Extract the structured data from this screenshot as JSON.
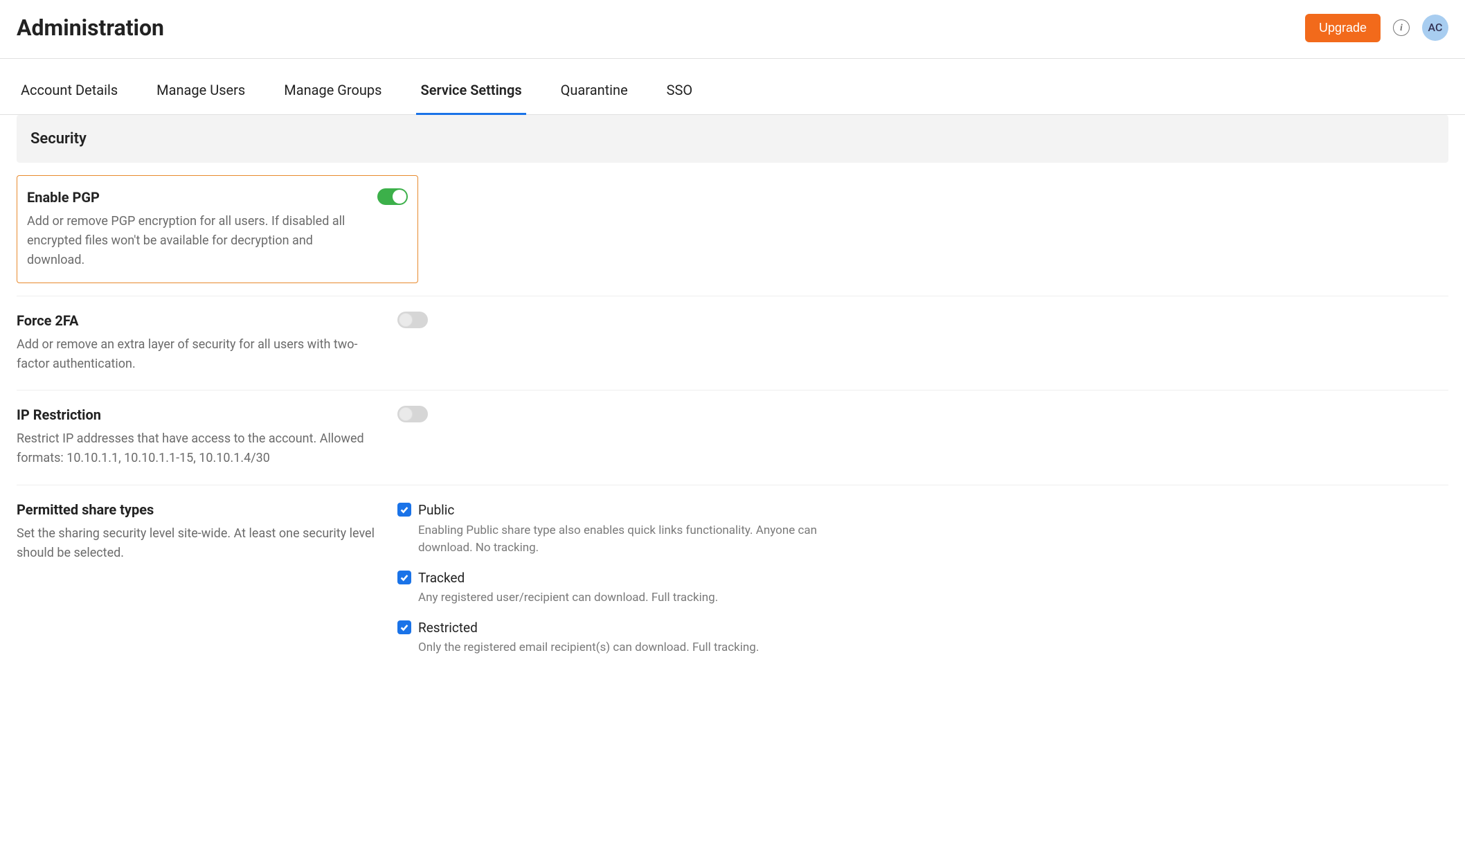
{
  "header": {
    "title": "Administration",
    "upgrade_label": "Upgrade",
    "avatar_initials": "AC"
  },
  "tabs": [
    {
      "label": "Account Details",
      "active": false
    },
    {
      "label": "Manage Users",
      "active": false
    },
    {
      "label": "Manage Groups",
      "active": false
    },
    {
      "label": "Service Settings",
      "active": true
    },
    {
      "label": "Quarantine",
      "active": false
    },
    {
      "label": "SSO",
      "active": false
    }
  ],
  "section": {
    "title": "Security"
  },
  "settings": {
    "enable_pgp": {
      "title": "Enable PGP",
      "desc": "Add or remove PGP encryption for all users. If disabled all encrypted files won't be available for decryption and download.",
      "on": true
    },
    "force_2fa": {
      "title": "Force 2FA",
      "desc": "Add or remove an extra layer of security for all users with two-factor authentication.",
      "on": false
    },
    "ip_restriction": {
      "title": "IP Restriction",
      "desc": "Restrict IP addresses that have access to the account. Allowed formats: 10.10.1.1, 10.10.1.1-15, 10.10.1.4/30",
      "on": false
    },
    "permitted_share_types": {
      "title": "Permitted share types",
      "desc": "Set the sharing security level site-wide. At least one security level should be selected.",
      "options": [
        {
          "key": "public",
          "label": "Public",
          "desc": "Enabling Public share type also enables quick links functionality. Anyone can download. No tracking.",
          "checked": true
        },
        {
          "key": "tracked",
          "label": "Tracked",
          "desc": "Any registered user/recipient can download. Full tracking.",
          "checked": true
        },
        {
          "key": "restricted",
          "label": "Restricted",
          "desc": "Only the registered email recipient(s) can download. Full tracking.",
          "checked": true
        }
      ]
    }
  }
}
